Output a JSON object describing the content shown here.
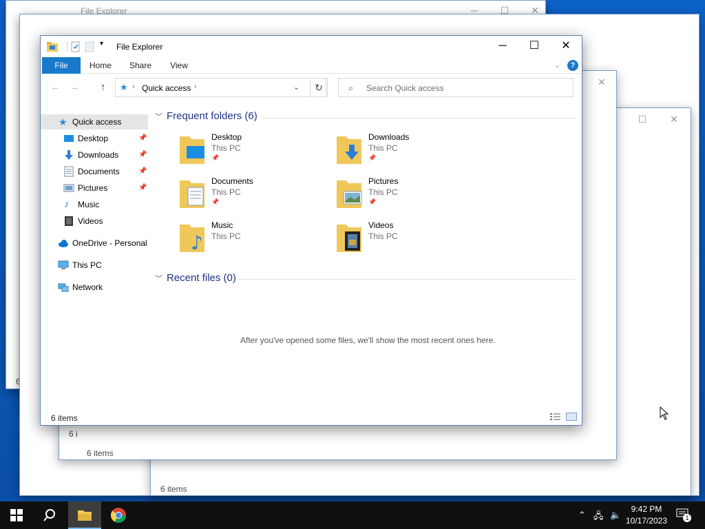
{
  "window": {
    "title": "File Explorer"
  },
  "ribbon": {
    "tabs": [
      "File",
      "Home",
      "Share",
      "View"
    ]
  },
  "address": {
    "path": "Quick access",
    "search_placeholder": "Search Quick access"
  },
  "sidebar": {
    "items": [
      {
        "label": "Quick access",
        "icon": "star-icon"
      },
      {
        "label": "Desktop",
        "icon": "desktop-icon"
      },
      {
        "label": "Downloads",
        "icon": "downloads-icon"
      },
      {
        "label": "Documents",
        "icon": "documents-icon"
      },
      {
        "label": "Pictures",
        "icon": "pictures-icon"
      },
      {
        "label": "Music",
        "icon": "music-icon"
      },
      {
        "label": "Videos",
        "icon": "videos-icon"
      },
      {
        "label": "OneDrive - Personal",
        "icon": "onedrive-icon"
      },
      {
        "label": "This PC",
        "icon": "this-pc-icon"
      },
      {
        "label": "Network",
        "icon": "network-icon"
      }
    ]
  },
  "content": {
    "frequent_header": "Frequent folders (6)",
    "recent_header": "Recent files (0)",
    "empty_message": "After you've opened some files, we'll show the most recent ones here.",
    "folders": [
      {
        "name": "Desktop",
        "location": "This PC"
      },
      {
        "name": "Downloads",
        "location": "This PC"
      },
      {
        "name": "Documents",
        "location": "This PC"
      },
      {
        "name": "Pictures",
        "location": "This PC"
      },
      {
        "name": "Music",
        "location": "This PC"
      },
      {
        "name": "Videos",
        "location": "This PC"
      }
    ]
  },
  "status": {
    "items": "6 items"
  },
  "background_windows": {
    "title": "File Explorer",
    "status_a": "6 items",
    "status_b": "6 items",
    "status_c": "6 i",
    "status_d": "6 i",
    "status_e": "6"
  },
  "taskbar": {
    "time": "9:42 PM",
    "date": "10/17/2023",
    "notification_count": "1"
  },
  "colors": {
    "accent": "#1979ca",
    "folder": "#f0c85a",
    "taskbar": "#101010",
    "group_header": "#1e3287"
  }
}
